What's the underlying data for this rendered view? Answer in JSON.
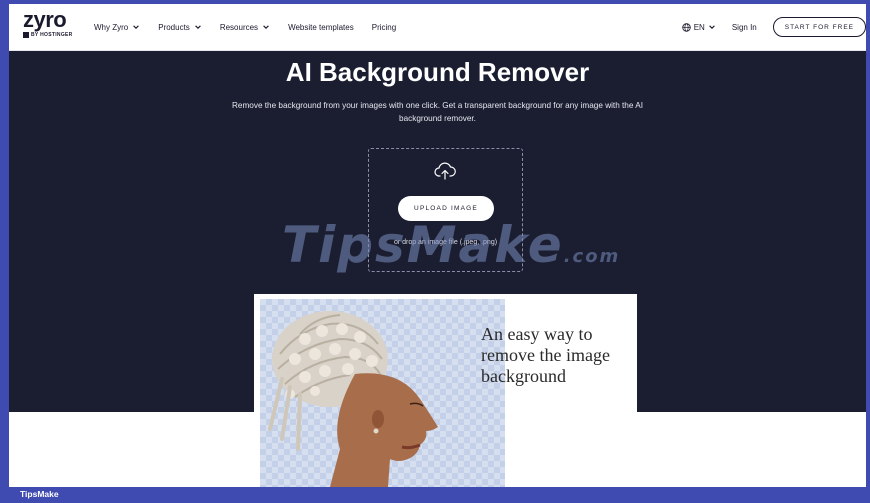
{
  "header": {
    "logo_text": "zyro",
    "logo_sub": "BY HOSTINGER",
    "nav": [
      {
        "label": "Why Zyro",
        "has_dropdown": true
      },
      {
        "label": "Products",
        "has_dropdown": true
      },
      {
        "label": "Resources",
        "has_dropdown": true
      },
      {
        "label": "Website templates",
        "has_dropdown": false
      },
      {
        "label": "Pricing",
        "has_dropdown": false
      }
    ],
    "language": "EN",
    "sign_in": "Sign In",
    "start_button": "START FOR FREE"
  },
  "hero": {
    "title": "AI Background Remover",
    "subtitle": "Remove the background from your images with one click. Get a transparent background for any image with the AI background remover.",
    "upload_button": "UPLOAD IMAGE",
    "drop_text": "or drop an image file (.jpeg, .png)"
  },
  "demo": {
    "text": "An easy way to remove the image background"
  },
  "watermark": {
    "main": "TipsMake",
    "suffix": ".com"
  },
  "footer": {
    "label": "TipsMake"
  },
  "colors": {
    "hero_bg": "#1b1e31",
    "frame": "#3f4bb0",
    "text_dark": "#1a1a2e"
  }
}
